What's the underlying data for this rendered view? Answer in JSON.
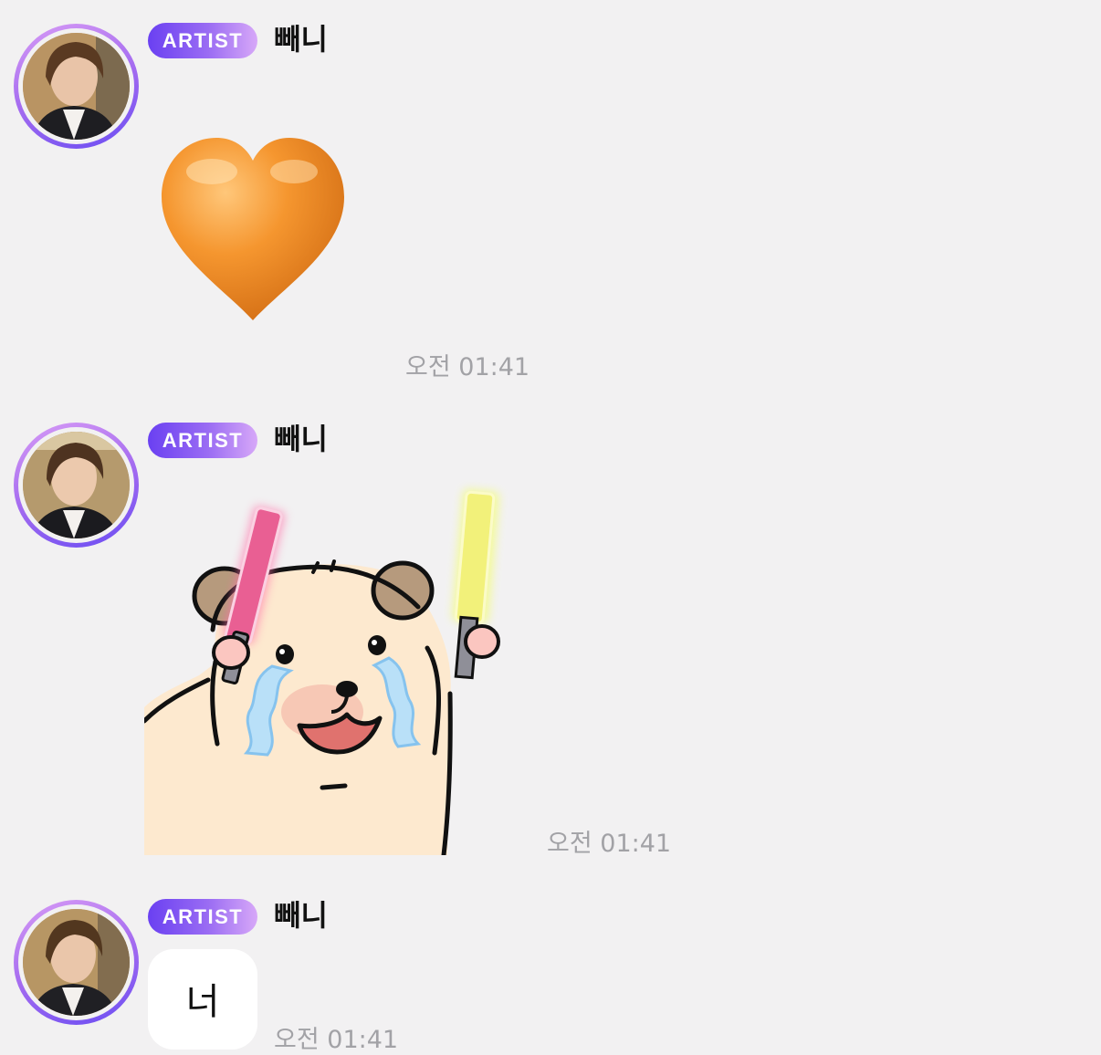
{
  "messages": [
    {
      "badge": "ARTIST",
      "sender": "빼니",
      "content_type": "emoji",
      "emoji": "orange-heart",
      "time": "오전 01:41"
    },
    {
      "badge": "ARTIST",
      "sender": "빼니",
      "content_type": "sticker",
      "sticker": "hamster-crying-with-lightsticks",
      "time": "오전 01:41"
    },
    {
      "badge": "ARTIST",
      "sender": "빼니",
      "content_type": "text",
      "text": "너",
      "time": "오전 01:41"
    }
  ],
  "colors": {
    "background": "#f2f1f2",
    "badge_gradient_start": "#6a40f2",
    "badge_gradient_end": "#d7a8f8",
    "avatar_ring": "#a56cf0",
    "timestamp": "#a2a2a6",
    "heart": "#f09230"
  }
}
